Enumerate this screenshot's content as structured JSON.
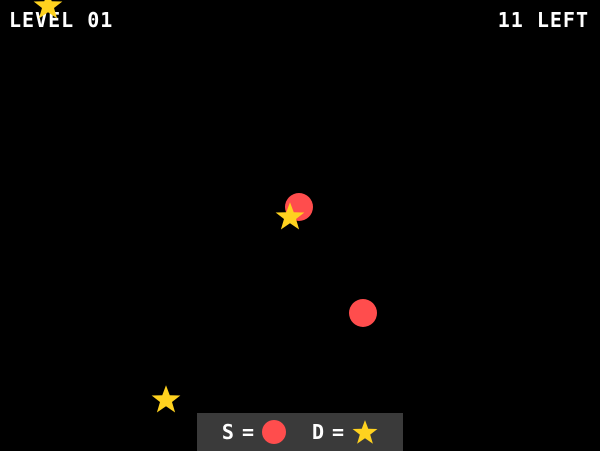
{
  "hud": {
    "level_text": "LEVEL 01",
    "remaining_text": "11 LEFT"
  },
  "colors": {
    "background": "#000000",
    "circle": "#ff4d4d",
    "star": "#ffd21f",
    "legend_bg": "#3a3a3a",
    "text": "#ffffff"
  },
  "legend": {
    "circle_key": "S",
    "circle_sep": "=",
    "circle_icon": "circle-icon",
    "star_key": "D",
    "star_sep": "=",
    "star_icon": "star-icon"
  }
}
